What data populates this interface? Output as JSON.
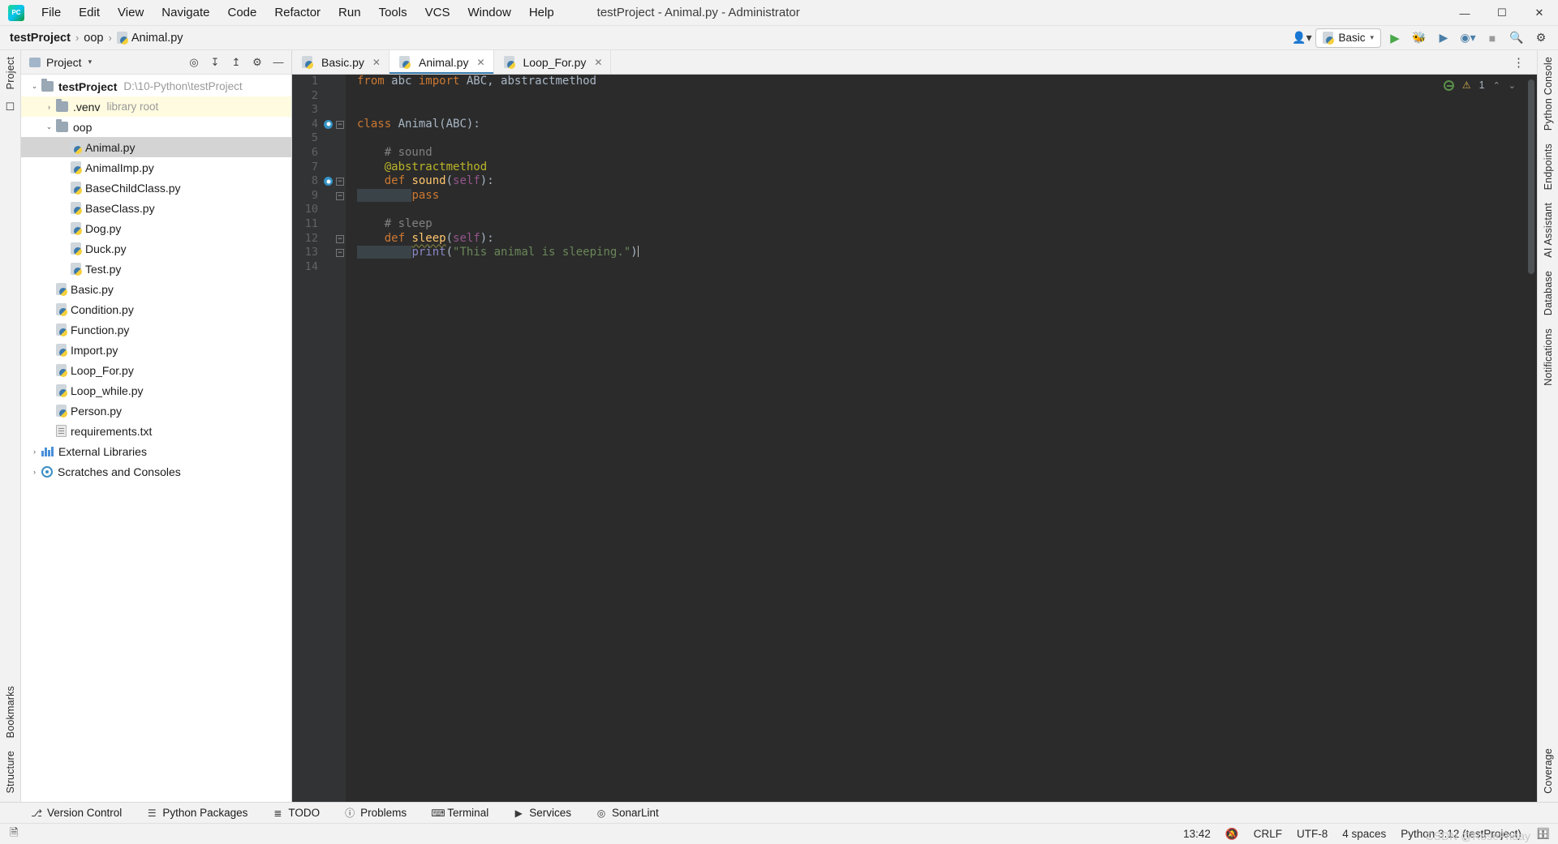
{
  "titlebar": {
    "logo_icon": "pycharm-logo-icon",
    "menus": [
      "File",
      "Edit",
      "View",
      "Navigate",
      "Code",
      "Refactor",
      "Run",
      "Tools",
      "VCS",
      "Window",
      "Help"
    ],
    "window_title": "testProject - Animal.py - Administrator",
    "controls": {
      "minimize": "—",
      "maximize": "☐",
      "close": "✕"
    }
  },
  "navbar": {
    "breadcrumbs": [
      {
        "label": "testProject",
        "icon": null
      },
      {
        "label": "oop",
        "icon": null
      },
      {
        "label": "Animal.py",
        "icon": "python-file-icon"
      }
    ],
    "separator": "›",
    "run_config": "Basic",
    "icons": {
      "account": "account-icon",
      "run": "run-icon",
      "debug": "debug-icon",
      "run_coverage": "run-with-coverage-icon",
      "profile": "profiler-icon",
      "stop": "stop-icon",
      "search": "search-icon",
      "settings": "settings-icon"
    }
  },
  "left_rail": {
    "project_label": "Project",
    "bookmarks_label": "Bookmarks",
    "structure_label": "Structure"
  },
  "project_panel": {
    "title": "Project",
    "caret": "▾",
    "actions": [
      "locate-icon",
      "expand-all-icon",
      "collapse-all-icon",
      "settings-icon",
      "hide-icon"
    ],
    "tree": [
      {
        "depth": 0,
        "twisty": "⌄",
        "icon": "folder-icon",
        "label": "testProject",
        "bold": true,
        "sub": "D:\\10-Python\\testProject",
        "state": "normal"
      },
      {
        "depth": 1,
        "twisty": "›",
        "icon": "folder-icon",
        "label": ".venv",
        "bold": false,
        "sub": "library root",
        "state": "highlight"
      },
      {
        "depth": 1,
        "twisty": "⌄",
        "icon": "folder-icon",
        "label": "oop",
        "bold": false,
        "sub": "",
        "state": "normal"
      },
      {
        "depth": 2,
        "twisty": "",
        "icon": "python-file-icon",
        "label": "Animal.py",
        "bold": false,
        "sub": "",
        "state": "selected"
      },
      {
        "depth": 2,
        "twisty": "",
        "icon": "python-file-icon",
        "label": "AnimalImp.py",
        "bold": false,
        "sub": "",
        "state": "normal"
      },
      {
        "depth": 2,
        "twisty": "",
        "icon": "python-file-icon",
        "label": "BaseChildClass.py",
        "bold": false,
        "sub": "",
        "state": "normal"
      },
      {
        "depth": 2,
        "twisty": "",
        "icon": "python-file-icon",
        "label": "BaseClass.py",
        "bold": false,
        "sub": "",
        "state": "normal"
      },
      {
        "depth": 2,
        "twisty": "",
        "icon": "python-file-icon",
        "label": "Dog.py",
        "bold": false,
        "sub": "",
        "state": "normal"
      },
      {
        "depth": 2,
        "twisty": "",
        "icon": "python-file-icon",
        "label": "Duck.py",
        "bold": false,
        "sub": "",
        "state": "normal"
      },
      {
        "depth": 2,
        "twisty": "",
        "icon": "python-file-icon",
        "label": "Test.py",
        "bold": false,
        "sub": "",
        "state": "normal"
      },
      {
        "depth": 1,
        "twisty": "",
        "icon": "python-file-icon",
        "label": "Basic.py",
        "bold": false,
        "sub": "",
        "state": "normal"
      },
      {
        "depth": 1,
        "twisty": "",
        "icon": "python-file-icon",
        "label": "Condition.py",
        "bold": false,
        "sub": "",
        "state": "normal"
      },
      {
        "depth": 1,
        "twisty": "",
        "icon": "python-file-icon",
        "label": "Function.py",
        "bold": false,
        "sub": "",
        "state": "normal"
      },
      {
        "depth": 1,
        "twisty": "",
        "icon": "python-file-icon",
        "label": "Import.py",
        "bold": false,
        "sub": "",
        "state": "normal"
      },
      {
        "depth": 1,
        "twisty": "",
        "icon": "python-file-icon",
        "label": "Loop_For.py",
        "bold": false,
        "sub": "",
        "state": "normal"
      },
      {
        "depth": 1,
        "twisty": "",
        "icon": "python-file-icon",
        "label": "Loop_while.py",
        "bold": false,
        "sub": "",
        "state": "normal"
      },
      {
        "depth": 1,
        "twisty": "",
        "icon": "python-file-icon",
        "label": "Person.py",
        "bold": false,
        "sub": "",
        "state": "normal"
      },
      {
        "depth": 1,
        "twisty": "",
        "icon": "text-file-icon",
        "label": "requirements.txt",
        "bold": false,
        "sub": "",
        "state": "normal"
      },
      {
        "depth": 0,
        "twisty": "›",
        "icon": "libraries-icon",
        "label": "External Libraries",
        "bold": false,
        "sub": "",
        "state": "normal"
      },
      {
        "depth": 0,
        "twisty": "›",
        "icon": "scratches-icon",
        "label": "Scratches and Consoles",
        "bold": false,
        "sub": "",
        "state": "normal"
      }
    ]
  },
  "editor": {
    "tabs": [
      {
        "label": "Basic.py",
        "icon": "python-file-icon",
        "active": false,
        "close": "✕"
      },
      {
        "label": "Animal.py",
        "icon": "python-file-icon",
        "active": true,
        "close": "✕"
      },
      {
        "label": "Loop_For.py",
        "icon": "python-file-icon",
        "active": false,
        "close": "✕"
      }
    ],
    "tabs_overflow": "⋮",
    "line_numbers": [
      "1",
      "2",
      "3",
      "4",
      "5",
      "6",
      "7",
      "8",
      "9",
      "10",
      "11",
      "12",
      "13",
      "14"
    ],
    "code_lines": [
      "from abc import ABC, abstractmethod",
      "",
      "",
      "class Animal(ABC):",
      "",
      "    # sound",
      "    @abstractmethod",
      "    def sound(self):",
      "        pass",
      "",
      "    # sleep",
      "    def sleep(self):",
      "        print(\"This animal is sleeping.\")",
      ""
    ],
    "inspection": {
      "ok_icon": "inspection-ok-icon",
      "warning_icon": "warning-triangle-icon",
      "warning_count": "1",
      "prev_icon": "⌃",
      "next_icon": "⌄"
    }
  },
  "right_rail": {
    "items": [
      "Python Console",
      "Endpoints",
      "AI Assistant",
      "Database",
      "Notifications",
      "Coverage"
    ]
  },
  "bottom_bar": {
    "tools": [
      {
        "label": "Version Control",
        "icon": "branch-icon"
      },
      {
        "label": "Python Packages",
        "icon": "packages-icon"
      },
      {
        "label": "TODO",
        "icon": "todo-list-icon"
      },
      {
        "label": "Problems",
        "icon": "problems-icon"
      },
      {
        "label": "Terminal",
        "icon": "terminal-icon"
      },
      {
        "label": "Services",
        "icon": "services-icon"
      },
      {
        "label": "SonarLint",
        "icon": "sonarlint-icon"
      }
    ]
  },
  "statusbar": {
    "left_icon": "editor-layout-icon",
    "time": "13:42",
    "no_notifications_icon": "bell-crossed-icon",
    "line_separator": "CRLF",
    "encoding": "UTF-8",
    "indent": "4 spaces",
    "interpreter": "Python 3.12 (testProject)",
    "lock_icon": "memory-icon",
    "watermark": "CSDN @RoseFriday"
  }
}
